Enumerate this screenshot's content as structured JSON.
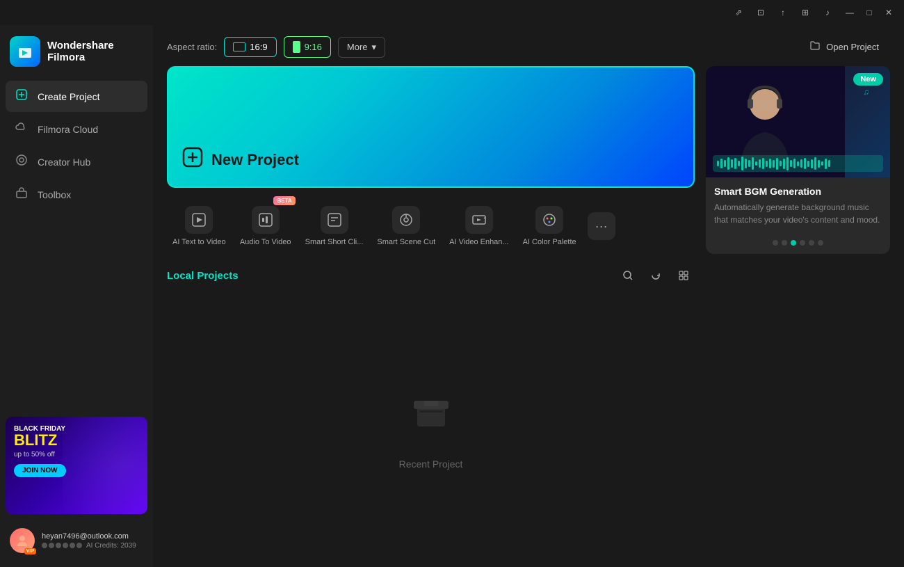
{
  "app": {
    "brand": "Wondershare",
    "product": "Filmora"
  },
  "titlebar": {
    "icons": [
      "share",
      "bookmark",
      "cloud-upload",
      "grid",
      "music-note"
    ],
    "minimize": "—",
    "maximize": "□",
    "close": "✕"
  },
  "sidebar": {
    "nav_items": [
      {
        "id": "create-project",
        "label": "Create Project",
        "icon": "➕",
        "active": true
      },
      {
        "id": "filmora-cloud",
        "label": "Filmora Cloud",
        "icon": "☁",
        "active": false
      },
      {
        "id": "creator-hub",
        "label": "Creator Hub",
        "icon": "◎",
        "active": false
      },
      {
        "id": "toolbox",
        "label": "Toolbox",
        "icon": "🧰",
        "active": false
      }
    ],
    "promo": {
      "line1": "BLACK FRIDAY",
      "line2": "BLITZ",
      "line3": "up to 50% off",
      "cta": "JOIN NOW"
    },
    "user": {
      "email": "heyan7496@outlook.com",
      "credits_label": "AI Credits: 2039"
    }
  },
  "topbar": {
    "aspect_label": "Aspect ratio:",
    "aspect_16_9": "16:9",
    "aspect_9_16": "9:16",
    "more_label": "More",
    "open_project": "Open Project"
  },
  "new_project": {
    "label": "New Project"
  },
  "features": [
    {
      "id": "ai-text-to-video",
      "label": "AI Text to Video",
      "icon": "⊞",
      "badge": null
    },
    {
      "id": "audio-to-video",
      "label": "Audio To Video",
      "icon": "⊡",
      "badge": "BETA"
    },
    {
      "id": "smart-short-cli",
      "label": "Smart Short Cli...",
      "icon": "⊠",
      "badge": null
    },
    {
      "id": "smart-scene-cut",
      "label": "Smart Scene Cut",
      "icon": "⊙",
      "badge": null
    },
    {
      "id": "ai-video-enhan",
      "label": "AI Video Enhan...",
      "icon": "⊛",
      "badge": null
    },
    {
      "id": "ai-color-palette",
      "label": "AI Color Palette",
      "icon": "⊜",
      "badge": null
    }
  ],
  "local_projects": {
    "title": "Local Projects",
    "empty_text": "Recent Project"
  },
  "promo_card": {
    "new_badge": "New",
    "title": "Smart BGM Generation",
    "description": "Automatically generate background music that matches your video's content and mood.",
    "dots": [
      false,
      false,
      true,
      false,
      false,
      false
    ]
  }
}
